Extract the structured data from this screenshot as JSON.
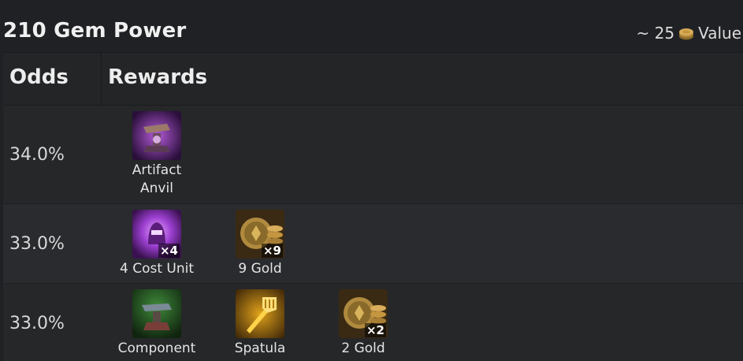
{
  "header": {
    "title": "210 Gem Power",
    "value_prefix": "~ 25",
    "value_icon": "gold-coin-icon",
    "value_suffix": "Value"
  },
  "table": {
    "columns": [
      "Odds",
      "Rewards"
    ],
    "rows": [
      {
        "odds": "34.0%",
        "rewards": [
          {
            "label": "Artifact\nAnvil",
            "icon": "artifact-anvil-icon",
            "qty": ""
          }
        ]
      },
      {
        "odds": "33.0%",
        "rewards": [
          {
            "label": "4 Cost Unit",
            "icon": "four-cost-unit-icon",
            "qty": "×4"
          },
          {
            "label": "9 Gold",
            "icon": "gold-coins-icon",
            "qty": "×9"
          }
        ]
      },
      {
        "odds": "33.0%",
        "rewards": [
          {
            "label": "Component",
            "icon": "component-anvil-icon",
            "qty": ""
          },
          {
            "label": "Spatula",
            "icon": "spatula-icon",
            "qty": ""
          },
          {
            "label": "2 Gold",
            "icon": "gold-coins-icon",
            "qty": "×2"
          }
        ]
      }
    ]
  },
  "colors": {
    "background": "#202124",
    "table": "#262729",
    "text": "#e6e6e6",
    "gold": "#c9a24a",
    "purple": "#8a3fb8"
  }
}
